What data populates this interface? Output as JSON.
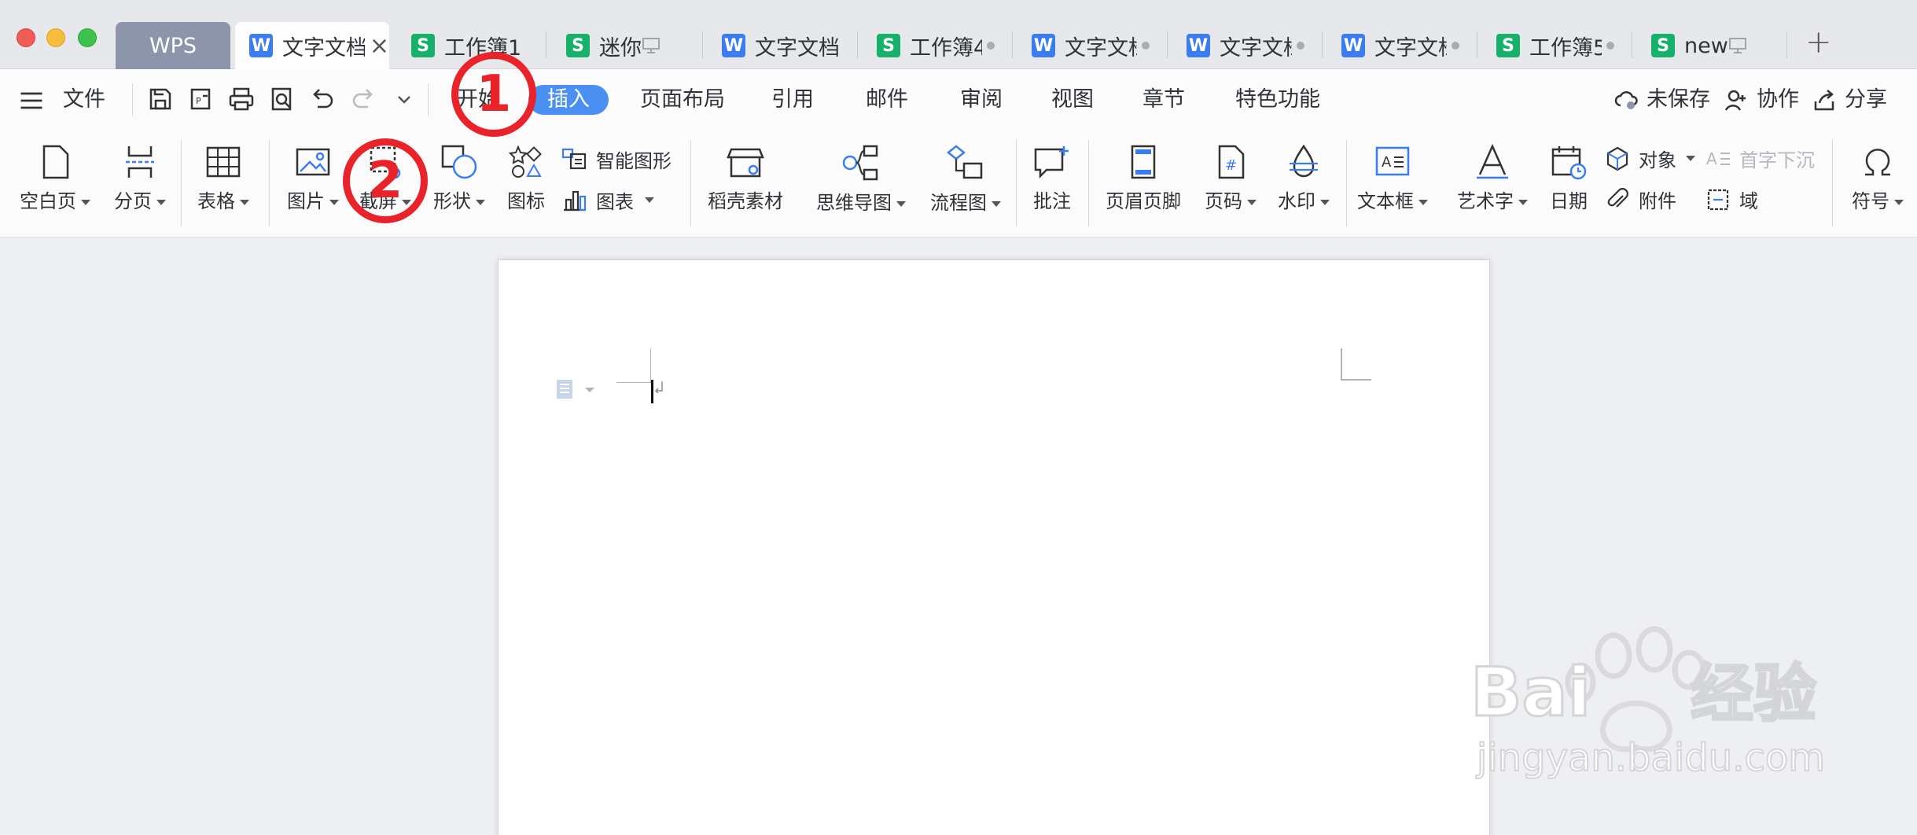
{
  "tabs": [
    {
      "label": "WPS",
      "type": "home"
    },
    {
      "label": "文字文档",
      "type": "w",
      "active": true
    },
    {
      "label": "工作簿1",
      "type": "s"
    },
    {
      "label": "迷你",
      "type": "s"
    },
    {
      "label": "文字文档",
      "type": "w"
    },
    {
      "label": "工作簿4",
      "type": "s"
    },
    {
      "label": "文字文档",
      "type": "w"
    },
    {
      "label": "文字文档",
      "type": "w"
    },
    {
      "label": "文字文档",
      "type": "w"
    },
    {
      "label": "工作簿5",
      "type": "s"
    },
    {
      "label": "new",
      "type": "s"
    }
  ],
  "menu": {
    "file": "文件",
    "items": [
      "开始",
      "插入",
      "页面布局",
      "引用",
      "邮件",
      "审阅",
      "视图",
      "章节",
      "特色功能"
    ],
    "selected": "插入",
    "right": {
      "unsaved": "未保存",
      "collab": "协作",
      "share": "分享"
    }
  },
  "ribbon": {
    "blank_page": "空白页",
    "page_break": "分页",
    "table": "表格",
    "picture": "图片",
    "screenshot": "截屏",
    "shape": "形状",
    "icon": "图标",
    "smart_shape": "智能图形",
    "chart": "图表",
    "resources": "稻壳素材",
    "mindmap": "思维导图",
    "flowchart": "流程图",
    "comment": "批注",
    "header_footer": "页眉页脚",
    "page_number": "页码",
    "watermark": "水印",
    "textbox": "文本框",
    "wordart": "艺术字",
    "date": "日期",
    "object": "对象",
    "attachment": "附件",
    "drop_cap": "首字下沉",
    "field": "域",
    "symbol": "符号"
  },
  "annotations": {
    "first": "1",
    "second": "2"
  },
  "watermark": {
    "brand": "Bai du 经验",
    "url": "jingyan.baidu.com"
  }
}
